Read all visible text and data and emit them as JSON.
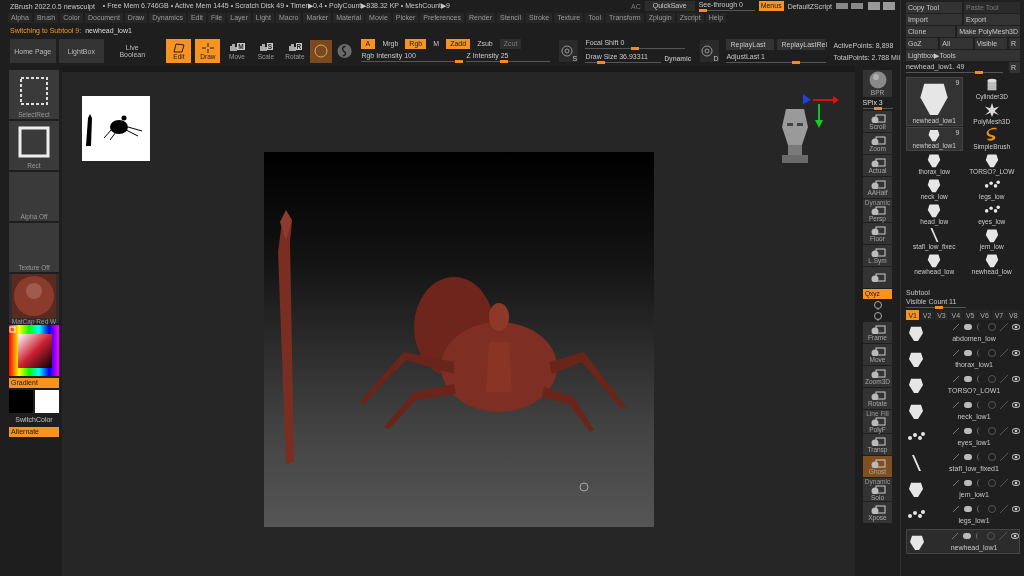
{
  "title_bar": {
    "app": "ZBrush 2022.0.5 newsculpt",
    "stats": "• Free Mem 6.746GB • Active Mem 1445 • Scratch Disk 49 •  Timer▶0.4 • PolyCount▶838.32 KP  • MeshCount▶9",
    "ac": "AC",
    "quicksave": "QuickSave",
    "see_through": {
      "label": "See-through  0",
      "level": 0
    },
    "menus": {
      "label": "Menus",
      "on": true
    },
    "script": "DefaultZScript"
  },
  "menu_bar": [
    "Alpha",
    "Brush",
    "Color",
    "Document",
    "Draw",
    "Dynamics",
    "Edit",
    "File",
    "Layer",
    "Light",
    "Macro",
    "Marker",
    "Material",
    "Movie",
    "Picker",
    "Preferences",
    "Render",
    "Stencil",
    "Stroke",
    "Texture",
    "Tool",
    "Transform",
    "Zplugin",
    "Zscript",
    "Help"
  ],
  "notice": {
    "label": "Switching to Subtool 9:",
    "value": "newhead_low1"
  },
  "top_shelf": {
    "nav_buttons": [
      {
        "label": "Home Page",
        "kind": "button"
      },
      {
        "label": "LightBox",
        "kind": "button"
      },
      {
        "label": "Live Boolean",
        "kind": "plain"
      }
    ],
    "modes": [
      {
        "label": "Edit",
        "on": true
      },
      {
        "label": "Draw",
        "on": true
      },
      {
        "label": "Move",
        "key": "M",
        "on": false
      },
      {
        "label": "Scale",
        "key": "S",
        "on": false
      },
      {
        "label": "Rotate",
        "key": "R",
        "on": false
      }
    ],
    "color_toggles": [
      {
        "label": "A",
        "on": true,
        "disabled": false
      },
      {
        "label": "Mrgb",
        "on": false,
        "disabled": false
      },
      {
        "label": "Rgb",
        "on": true,
        "disabled": false
      },
      {
        "label": "M",
        "on": false,
        "disabled": false
      }
    ],
    "z_toggles": [
      {
        "label": "Zadd",
        "on": true,
        "disabled": false
      },
      {
        "label": "Zsub",
        "on": false,
        "disabled": false
      },
      {
        "label": "Zcut",
        "on": false,
        "disabled": true
      }
    ],
    "rgb_intensity": {
      "label": "Rgb Intensity 100",
      "level": 1
    },
    "z_intensity": {
      "label": "Z Intensity 25",
      "level": 0.45
    },
    "focal_badge": "S",
    "focal_shift": {
      "label": "Focal Shift 0",
      "level": 0.5
    },
    "draw_size": {
      "label": "Draw Size 36.93311",
      "level": 0.2
    },
    "dynamic": "Dynamic",
    "replay_badge": "D",
    "replay": [
      "ReplayLast",
      "ReplayLastRel"
    ],
    "adjust_last": {
      "label": "AdjustLast 1",
      "level": 0.7
    },
    "active_points": "ActivePoints: 8,898",
    "total_points": "TotalPoints: 2.788 Mil"
  },
  "left_shelf": {
    "tiles": [
      {
        "label": "SelectRect",
        "kind": "select"
      },
      {
        "label": "Rect",
        "kind": "rect"
      },
      {
        "label": "Alpha Off",
        "kind": "empty"
      },
      {
        "label": "Texture Off",
        "kind": "empty"
      },
      {
        "label": "MatCap Red W",
        "kind": "material"
      }
    ],
    "gradient": {
      "label": "Gradient",
      "on": true
    },
    "switch_color": "SwitchColor",
    "alternate": {
      "label": "Alternate",
      "on": true
    }
  },
  "right_shelf": [
    {
      "kind": "render",
      "label": "BPR"
    },
    {
      "kind": "slider",
      "label": "SPix 3",
      "level": 0.5
    },
    {
      "kind": "button",
      "label": "Scroll",
      "on": false
    },
    {
      "kind": "button",
      "label": "Zoom",
      "on": false
    },
    {
      "kind": "button",
      "label": "Actual",
      "on": false
    },
    {
      "kind": "button",
      "label": "AAHalf",
      "on": false
    },
    {
      "kind": "button",
      "label": "Persp",
      "caption": "Dynamic",
      "on": false
    },
    {
      "kind": "button",
      "label": "Floor",
      "on": false
    },
    {
      "kind": "button",
      "label": "L.Sym",
      "on": false
    },
    {
      "kind": "button",
      "on": false
    },
    {
      "kind": "toggle",
      "label": "Qxyz",
      "on": true
    },
    {
      "kind": "icon"
    },
    {
      "kind": "icon"
    },
    {
      "kind": "button",
      "label": "Frame",
      "on": false
    },
    {
      "kind": "button",
      "label": "Move",
      "on": false
    },
    {
      "kind": "button",
      "label": "Zoom3D",
      "on": false
    },
    {
      "kind": "button",
      "label": "Rotate",
      "on": false
    },
    {
      "kind": "button",
      "label": "PolyF",
      "caption": "Line Fill",
      "on": false
    },
    {
      "kind": "button",
      "label": "Transp",
      "on": false
    },
    {
      "kind": "button",
      "label": "Ghost",
      "on": true
    },
    {
      "kind": "button",
      "label": "Solo",
      "caption": "Dynamic",
      "on": false
    },
    {
      "kind": "button",
      "label": "Xpose",
      "on": false
    }
  ],
  "tool_panel": {
    "button_rows": [
      [
        {
          "label": "Copy Tool",
          "disabled": false
        },
        {
          "label": "Paste Tool",
          "disabled": true
        }
      ],
      [
        {
          "label": "Import",
          "disabled": false
        },
        {
          "label": "Export",
          "disabled": false
        }
      ],
      [
        {
          "label": "Clone",
          "disabled": false
        },
        {
          "label": "Make PolyMesh3D",
          "disabled": false
        }
      ],
      [
        {
          "label": "GoZ",
          "disabled": false
        },
        {
          "label": "All",
          "disabled": false
        },
        {
          "label": "Visible",
          "disabled": false
        },
        {
          "label": "R",
          "disabled": false
        }
      ],
      [
        {
          "label": "Lightbox▶Tools",
          "disabled": false
        }
      ]
    ],
    "current": {
      "label": "newhead_low1. 49",
      "level": 0.75,
      "reset": "R"
    },
    "tools": [
      {
        "name": "newhead_low1",
        "count": "9",
        "kind": "mesh",
        "selected": true
      },
      {
        "name": "Cylinder3D",
        "kind": "cylinder",
        "selected": false
      },
      {
        "name": "PolyMesh3D",
        "kind": "star",
        "selected": false
      },
      {
        "name": "newhead_low1",
        "count": "9",
        "kind": "mesh",
        "selected": false
      },
      {
        "name": "SimpleBrush",
        "kind": "brush",
        "selected": false
      },
      {
        "name": "thorax_low",
        "kind": "mesh",
        "selected": false
      },
      {
        "name": "TORSO?_LOW",
        "kind": "mesh",
        "selected": false
      },
      {
        "name": "neck_low",
        "kind": "mesh",
        "selected": false
      },
      {
        "name": "legs_low",
        "kind": "dots",
        "selected": false
      },
      {
        "name": "head_low",
        "kind": "mesh",
        "selected": false
      },
      {
        "name": "eyes_low",
        "kind": "dots",
        "selected": false
      },
      {
        "name": "stafl_low_fixec",
        "kind": "stick",
        "selected": false
      },
      {
        "name": "jem_low",
        "kind": "mesh",
        "selected": false
      },
      {
        "name": "newhead_low",
        "kind": "mesh",
        "selected": false
      },
      {
        "name": "newhead_low",
        "kind": "mesh",
        "selected": false
      }
    ]
  },
  "subtool": {
    "title": "Subtool",
    "visible_count": {
      "label": "Visible Count 11",
      "level": 0.55
    },
    "tabs": [
      {
        "label": "V1",
        "selected": true
      },
      {
        "label": "V2",
        "selected": false
      },
      {
        "label": "V3",
        "selected": false
      },
      {
        "label": "V4",
        "selected": false
      },
      {
        "label": "V5",
        "selected": false
      },
      {
        "label": "V6",
        "selected": false
      },
      {
        "label": "V7",
        "selected": false
      },
      {
        "label": "V8",
        "selected": false
      }
    ],
    "items": [
      {
        "name": "abdomen_low",
        "kind": "mesh",
        "selected": false
      },
      {
        "name": "thorax_low1",
        "kind": "mesh",
        "selected": false
      },
      {
        "name": "TORSO?_LOW1",
        "kind": "mesh",
        "selected": false
      },
      {
        "name": "neck_low1",
        "kind": "mesh",
        "selected": false
      },
      {
        "name": "eyes_low1",
        "kind": "dots",
        "selected": false
      },
      {
        "name": "stafl_low_fixed1",
        "kind": "stick",
        "selected": false
      },
      {
        "name": "jem_low1",
        "kind": "mesh",
        "selected": false
      },
      {
        "name": "legs_low1",
        "kind": "dots",
        "selected": false
      },
      {
        "name": "newhead_low1",
        "kind": "mesh",
        "selected": true
      }
    ]
  }
}
